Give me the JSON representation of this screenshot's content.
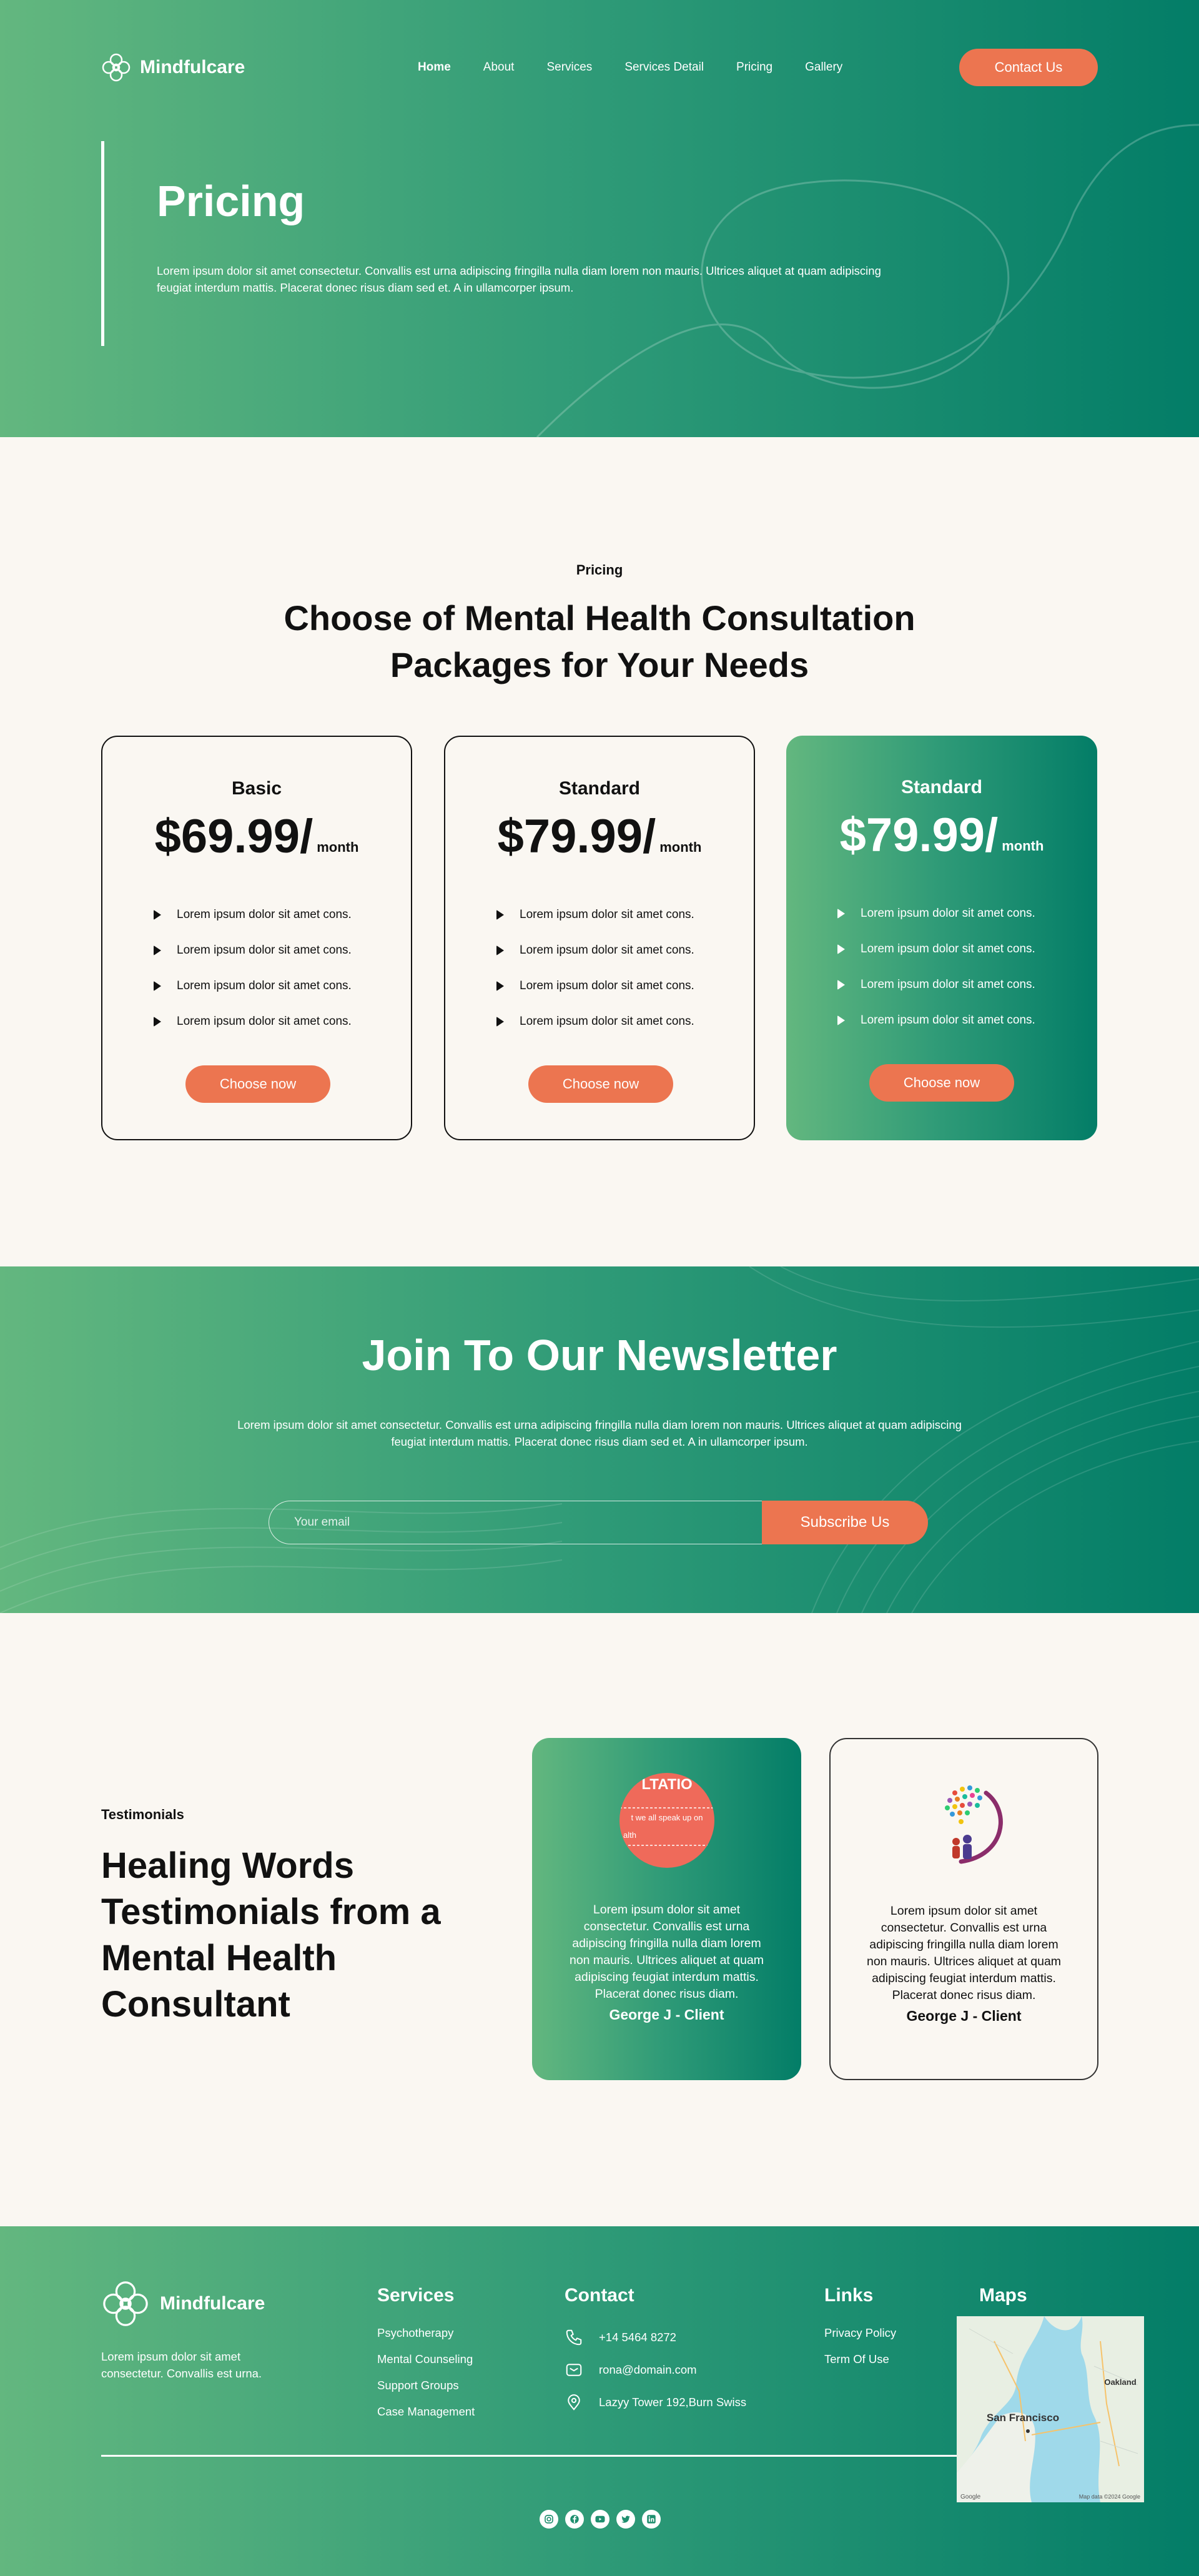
{
  "brand": {
    "name": "Mindfulcare"
  },
  "nav": {
    "items": [
      {
        "label": "Home",
        "active": true
      },
      {
        "label": "About"
      },
      {
        "label": "Services"
      },
      {
        "label": "Services Detail"
      },
      {
        "label": "Pricing"
      },
      {
        "label": "Gallery"
      }
    ],
    "contact_label": "Contact Us"
  },
  "hero": {
    "title": "Pricing",
    "description": "Lorem ipsum dolor sit amet consectetur. Convallis est urna adipiscing fringilla nulla diam lorem non mauris. Ultrices aliquet at quam adipiscing feugiat interdum mattis. Placerat donec risus diam sed et. A in ullamcorper ipsum."
  },
  "pricing": {
    "eyebrow": "Pricing",
    "title": "Choose of Mental Health Consultation Packages for Your Needs",
    "plans": [
      {
        "name": "Basic",
        "price": "$69.99/",
        "unit": "month",
        "features": [
          "Lorem ipsum dolor sit amet cons.",
          "Lorem ipsum dolor sit amet cons.",
          "Lorem ipsum dolor sit amet cons.",
          "Lorem ipsum dolor sit amet cons."
        ],
        "button": "Choose now"
      },
      {
        "name": "Standard",
        "price": "$79.99/",
        "unit": "month",
        "features": [
          "Lorem ipsum dolor sit amet cons.",
          "Lorem ipsum dolor sit amet cons.",
          "Lorem ipsum dolor sit amet cons.",
          "Lorem ipsum dolor sit amet cons."
        ],
        "button": "Choose now"
      },
      {
        "name": "Standard",
        "price": "$79.99/",
        "unit": "month",
        "features": [
          "Lorem ipsum dolor sit amet cons.",
          "Lorem ipsum dolor sit amet cons.",
          "Lorem ipsum dolor sit amet cons.",
          "Lorem ipsum dolor sit amet cons."
        ],
        "button": "Choose now"
      }
    ]
  },
  "newsletter": {
    "title": "Join To Our Newsletter",
    "description": "Lorem ipsum dolor sit amet consectetur. Convallis est urna adipiscing fringilla nulla diam lorem non mauris. Ultrices aliquet at quam adipiscing feugiat interdum mattis. Placerat donec risus diam sed et. A in ullamcorper ipsum.",
    "email_placeholder": "Your email",
    "button": "Subscribe Us"
  },
  "testimonials": {
    "eyebrow": "Testimonials",
    "title": "Healing Words Testimonials from a Mental Health Consultant",
    "items": [
      {
        "avatar_text_top": "LTATIO",
        "avatar_text_mid": "t we all speak up on",
        "avatar_text_bottom": "alth",
        "quote": "Lorem ipsum dolor sit amet consectetur. Convallis est urna adipiscing fringilla nulla diam lorem non mauris. Ultrices aliquet at quam adipiscing feugiat interdum mattis. Placerat donec risus diam.",
        "name": "George J - Client"
      },
      {
        "quote": "Lorem ipsum dolor sit amet consectetur. Convallis est urna adipiscing fringilla nulla diam lorem non mauris. Ultrices aliquet at quam adipiscing feugiat interdum mattis. Placerat donec risus diam.",
        "name": "George J - Client"
      }
    ]
  },
  "footer": {
    "description": "Lorem ipsum dolor sit amet consectetur. Convallis est urna.",
    "services": {
      "title": "Services",
      "items": [
        "Psychotherapy",
        "Mental Counseling",
        "Support Groups",
        "Case Management"
      ]
    },
    "contact": {
      "title": "Contact",
      "phone": "+14 5464 8272",
      "email": "rona@domain.com",
      "address": "Lazyy Tower 192,Burn Swiss"
    },
    "links": {
      "title": "Links",
      "items": [
        "Privacy Policy",
        "Term Of Use"
      ]
    },
    "maps": {
      "title": "Maps",
      "city": "San Francisco",
      "city2": "Oakland",
      "attribution": "Map data ©2024 Google",
      "provider": "Google"
    },
    "social_icons": [
      "instagram-icon",
      "facebook-icon",
      "youtube-icon",
      "twitter-icon",
      "linkedin-icon"
    ]
  },
  "colors": {
    "accent": "#ec7550",
    "green_start": "#63b77f",
    "green_end": "#037d67",
    "background": "#faf7f2"
  }
}
